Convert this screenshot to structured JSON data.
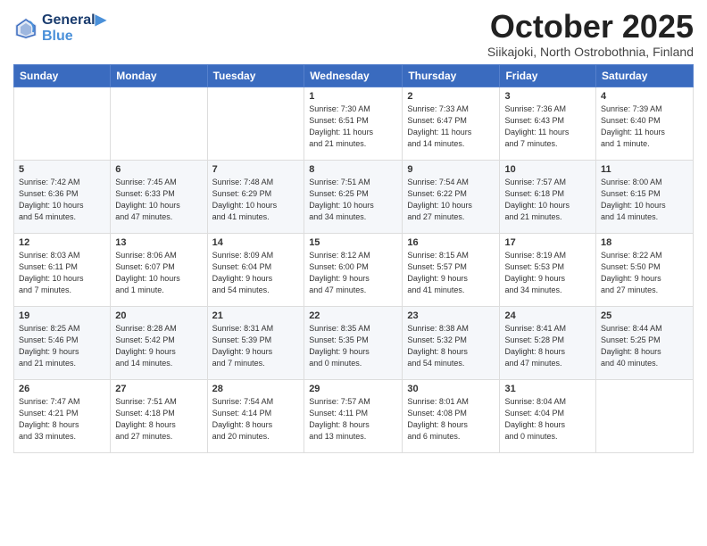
{
  "header": {
    "logo_line1": "General",
    "logo_line2": "Blue",
    "title": "October 2025",
    "subtitle": "Siikajoki, North Ostrobothnia, Finland"
  },
  "weekdays": [
    "Sunday",
    "Monday",
    "Tuesday",
    "Wednesday",
    "Thursday",
    "Friday",
    "Saturday"
  ],
  "weeks": [
    [
      {
        "day": "",
        "info": ""
      },
      {
        "day": "",
        "info": ""
      },
      {
        "day": "",
        "info": ""
      },
      {
        "day": "1",
        "info": "Sunrise: 7:30 AM\nSunset: 6:51 PM\nDaylight: 11 hours\nand 21 minutes."
      },
      {
        "day": "2",
        "info": "Sunrise: 7:33 AM\nSunset: 6:47 PM\nDaylight: 11 hours\nand 14 minutes."
      },
      {
        "day": "3",
        "info": "Sunrise: 7:36 AM\nSunset: 6:43 PM\nDaylight: 11 hours\nand 7 minutes."
      },
      {
        "day": "4",
        "info": "Sunrise: 7:39 AM\nSunset: 6:40 PM\nDaylight: 11 hours\nand 1 minute."
      }
    ],
    [
      {
        "day": "5",
        "info": "Sunrise: 7:42 AM\nSunset: 6:36 PM\nDaylight: 10 hours\nand 54 minutes."
      },
      {
        "day": "6",
        "info": "Sunrise: 7:45 AM\nSunset: 6:33 PM\nDaylight: 10 hours\nand 47 minutes."
      },
      {
        "day": "7",
        "info": "Sunrise: 7:48 AM\nSunset: 6:29 PM\nDaylight: 10 hours\nand 41 minutes."
      },
      {
        "day": "8",
        "info": "Sunrise: 7:51 AM\nSunset: 6:25 PM\nDaylight: 10 hours\nand 34 minutes."
      },
      {
        "day": "9",
        "info": "Sunrise: 7:54 AM\nSunset: 6:22 PM\nDaylight: 10 hours\nand 27 minutes."
      },
      {
        "day": "10",
        "info": "Sunrise: 7:57 AM\nSunset: 6:18 PM\nDaylight: 10 hours\nand 21 minutes."
      },
      {
        "day": "11",
        "info": "Sunrise: 8:00 AM\nSunset: 6:15 PM\nDaylight: 10 hours\nand 14 minutes."
      }
    ],
    [
      {
        "day": "12",
        "info": "Sunrise: 8:03 AM\nSunset: 6:11 PM\nDaylight: 10 hours\nand 7 minutes."
      },
      {
        "day": "13",
        "info": "Sunrise: 8:06 AM\nSunset: 6:07 PM\nDaylight: 10 hours\nand 1 minute."
      },
      {
        "day": "14",
        "info": "Sunrise: 8:09 AM\nSunset: 6:04 PM\nDaylight: 9 hours\nand 54 minutes."
      },
      {
        "day": "15",
        "info": "Sunrise: 8:12 AM\nSunset: 6:00 PM\nDaylight: 9 hours\nand 47 minutes."
      },
      {
        "day": "16",
        "info": "Sunrise: 8:15 AM\nSunset: 5:57 PM\nDaylight: 9 hours\nand 41 minutes."
      },
      {
        "day": "17",
        "info": "Sunrise: 8:19 AM\nSunset: 5:53 PM\nDaylight: 9 hours\nand 34 minutes."
      },
      {
        "day": "18",
        "info": "Sunrise: 8:22 AM\nSunset: 5:50 PM\nDaylight: 9 hours\nand 27 minutes."
      }
    ],
    [
      {
        "day": "19",
        "info": "Sunrise: 8:25 AM\nSunset: 5:46 PM\nDaylight: 9 hours\nand 21 minutes."
      },
      {
        "day": "20",
        "info": "Sunrise: 8:28 AM\nSunset: 5:42 PM\nDaylight: 9 hours\nand 14 minutes."
      },
      {
        "day": "21",
        "info": "Sunrise: 8:31 AM\nSunset: 5:39 PM\nDaylight: 9 hours\nand 7 minutes."
      },
      {
        "day": "22",
        "info": "Sunrise: 8:35 AM\nSunset: 5:35 PM\nDaylight: 9 hours\nand 0 minutes."
      },
      {
        "day": "23",
        "info": "Sunrise: 8:38 AM\nSunset: 5:32 PM\nDaylight: 8 hours\nand 54 minutes."
      },
      {
        "day": "24",
        "info": "Sunrise: 8:41 AM\nSunset: 5:28 PM\nDaylight: 8 hours\nand 47 minutes."
      },
      {
        "day": "25",
        "info": "Sunrise: 8:44 AM\nSunset: 5:25 PM\nDaylight: 8 hours\nand 40 minutes."
      }
    ],
    [
      {
        "day": "26",
        "info": "Sunrise: 7:47 AM\nSunset: 4:21 PM\nDaylight: 8 hours\nand 33 minutes."
      },
      {
        "day": "27",
        "info": "Sunrise: 7:51 AM\nSunset: 4:18 PM\nDaylight: 8 hours\nand 27 minutes."
      },
      {
        "day": "28",
        "info": "Sunrise: 7:54 AM\nSunset: 4:14 PM\nDaylight: 8 hours\nand 20 minutes."
      },
      {
        "day": "29",
        "info": "Sunrise: 7:57 AM\nSunset: 4:11 PM\nDaylight: 8 hours\nand 13 minutes."
      },
      {
        "day": "30",
        "info": "Sunrise: 8:01 AM\nSunset: 4:08 PM\nDaylight: 8 hours\nand 6 minutes."
      },
      {
        "day": "31",
        "info": "Sunrise: 8:04 AM\nSunset: 4:04 PM\nDaylight: 8 hours\nand 0 minutes."
      },
      {
        "day": "",
        "info": ""
      }
    ]
  ]
}
